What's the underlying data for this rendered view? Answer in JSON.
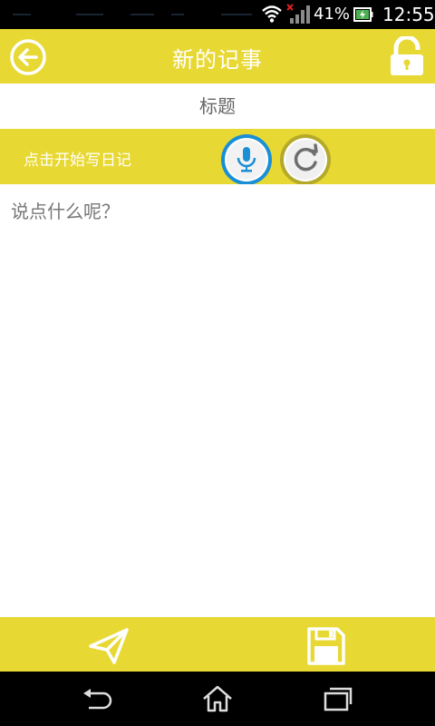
{
  "status_bar": {
    "battery": "41%",
    "time": "12:55"
  },
  "header": {
    "title": "新的记事",
    "back_icon": "back-arrow-circle-icon",
    "lock_icon": "lock-icon"
  },
  "title_field": {
    "placeholder": "标题",
    "value": ""
  },
  "voice_bar": {
    "label": "点击开始写日记",
    "mic_icon": "microphone-icon",
    "refresh_icon": "refresh-icon"
  },
  "content_field": {
    "placeholder": "说点什么呢？",
    "value": ""
  },
  "toolbar": {
    "send_icon": "paper-plane-icon",
    "save_icon": "floppy-disk-icon"
  },
  "colors": {
    "accent": "#e8d834",
    "mic_ring": "#1a8fd6",
    "refresh_ring": "#b5a92a"
  }
}
